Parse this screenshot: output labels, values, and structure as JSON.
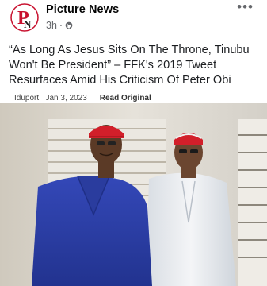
{
  "post": {
    "page_name": "Picture News",
    "time_ago": "3h",
    "time_separator": "·",
    "more_label": "•••",
    "headline": "“As Long As Jesus Sits On The Throne, Tinubu Won't Be President” – FFK's 2019 Tweet Resurfaces Amid His Criticism Of Peter Obi",
    "source_line": {
      "source": "Iduport",
      "date": "Jan 3, 2023",
      "read_link": "Read Original"
    }
  },
  "icons": {
    "logo": "picture-news-logo",
    "audience": "globe-icon",
    "more": "more-options-icon"
  },
  "colors": {
    "logo_red": "#c8102e",
    "secondary_text": "#65676b",
    "left_man_suit": "#2b3fa8",
    "cap_red": "#d21f2a"
  }
}
